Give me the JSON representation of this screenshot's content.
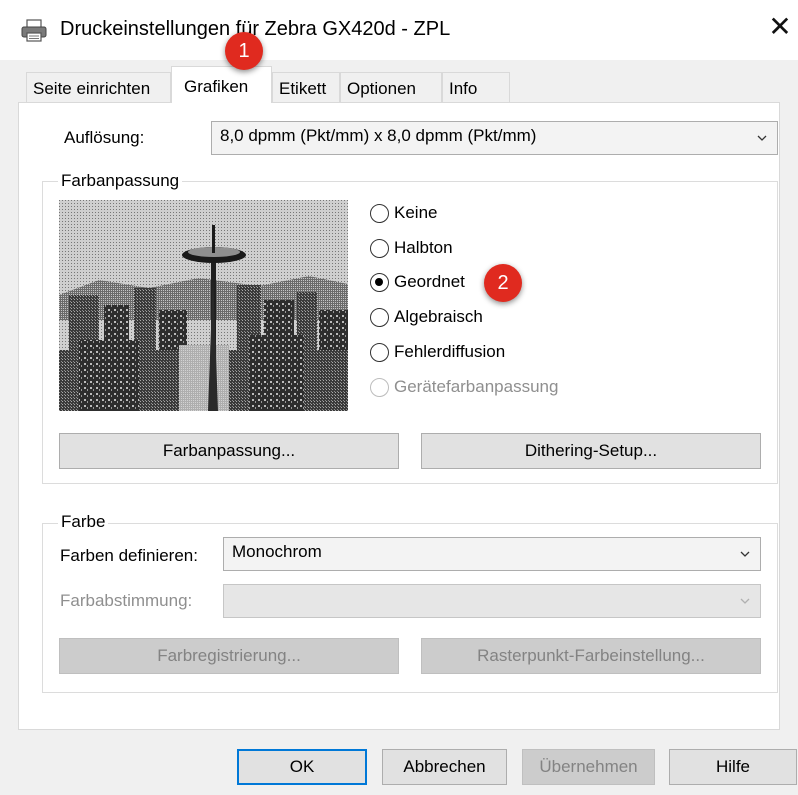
{
  "window": {
    "title": "Druckeinstellungen für Zebra GX420d - ZPL",
    "close_glyph": "✕"
  },
  "tabs": [
    {
      "label": "Seite einrichten",
      "active": false
    },
    {
      "label": "Grafiken",
      "active": true
    },
    {
      "label": "Etikett",
      "active": false
    },
    {
      "label": "Optionen",
      "active": false
    },
    {
      "label": "Info",
      "active": false
    }
  ],
  "resolution": {
    "label": "Auflösung:",
    "value": "8,0 dpmm (Pkt/mm) x 8,0 dpmm (Pkt/mm)"
  },
  "color_matching": {
    "group_label": "Farbanpassung",
    "options": [
      {
        "label": "Keine",
        "checked": false,
        "enabled": true
      },
      {
        "label": "Halbton",
        "checked": false,
        "enabled": true
      },
      {
        "label": "Geordnet",
        "checked": true,
        "enabled": true
      },
      {
        "label": "Algebraisch",
        "checked": false,
        "enabled": true
      },
      {
        "label": "Fehlerdiffusion",
        "checked": false,
        "enabled": true
      },
      {
        "label": "Gerätefarbanpassung",
        "checked": false,
        "enabled": false
      }
    ],
    "buttons": {
      "color_matching": "Farbanpassung...",
      "dithering_setup": "Dithering-Setup..."
    }
  },
  "color": {
    "group_label": "Farbe",
    "define_label": "Farben definieren:",
    "define_value": "Monochrom",
    "tuning_label": "Farbabstimmung:",
    "tuning_value": "",
    "buttons": {
      "registration": "Farbregistrierung...",
      "raster_setting": "Rasterpunkt-Farbeinstellung..."
    }
  },
  "footer": {
    "ok": "OK",
    "cancel": "Abbrechen",
    "apply": "Übernehmen",
    "help": "Hilfe"
  },
  "annotations": {
    "badge1": "1",
    "badge2": "2",
    "badge_color": "#e02a1f"
  },
  "colors": {
    "accent": "#0078d7",
    "dialog_bg": "#f0f0f0",
    "panel_bg": "#ffffff"
  }
}
